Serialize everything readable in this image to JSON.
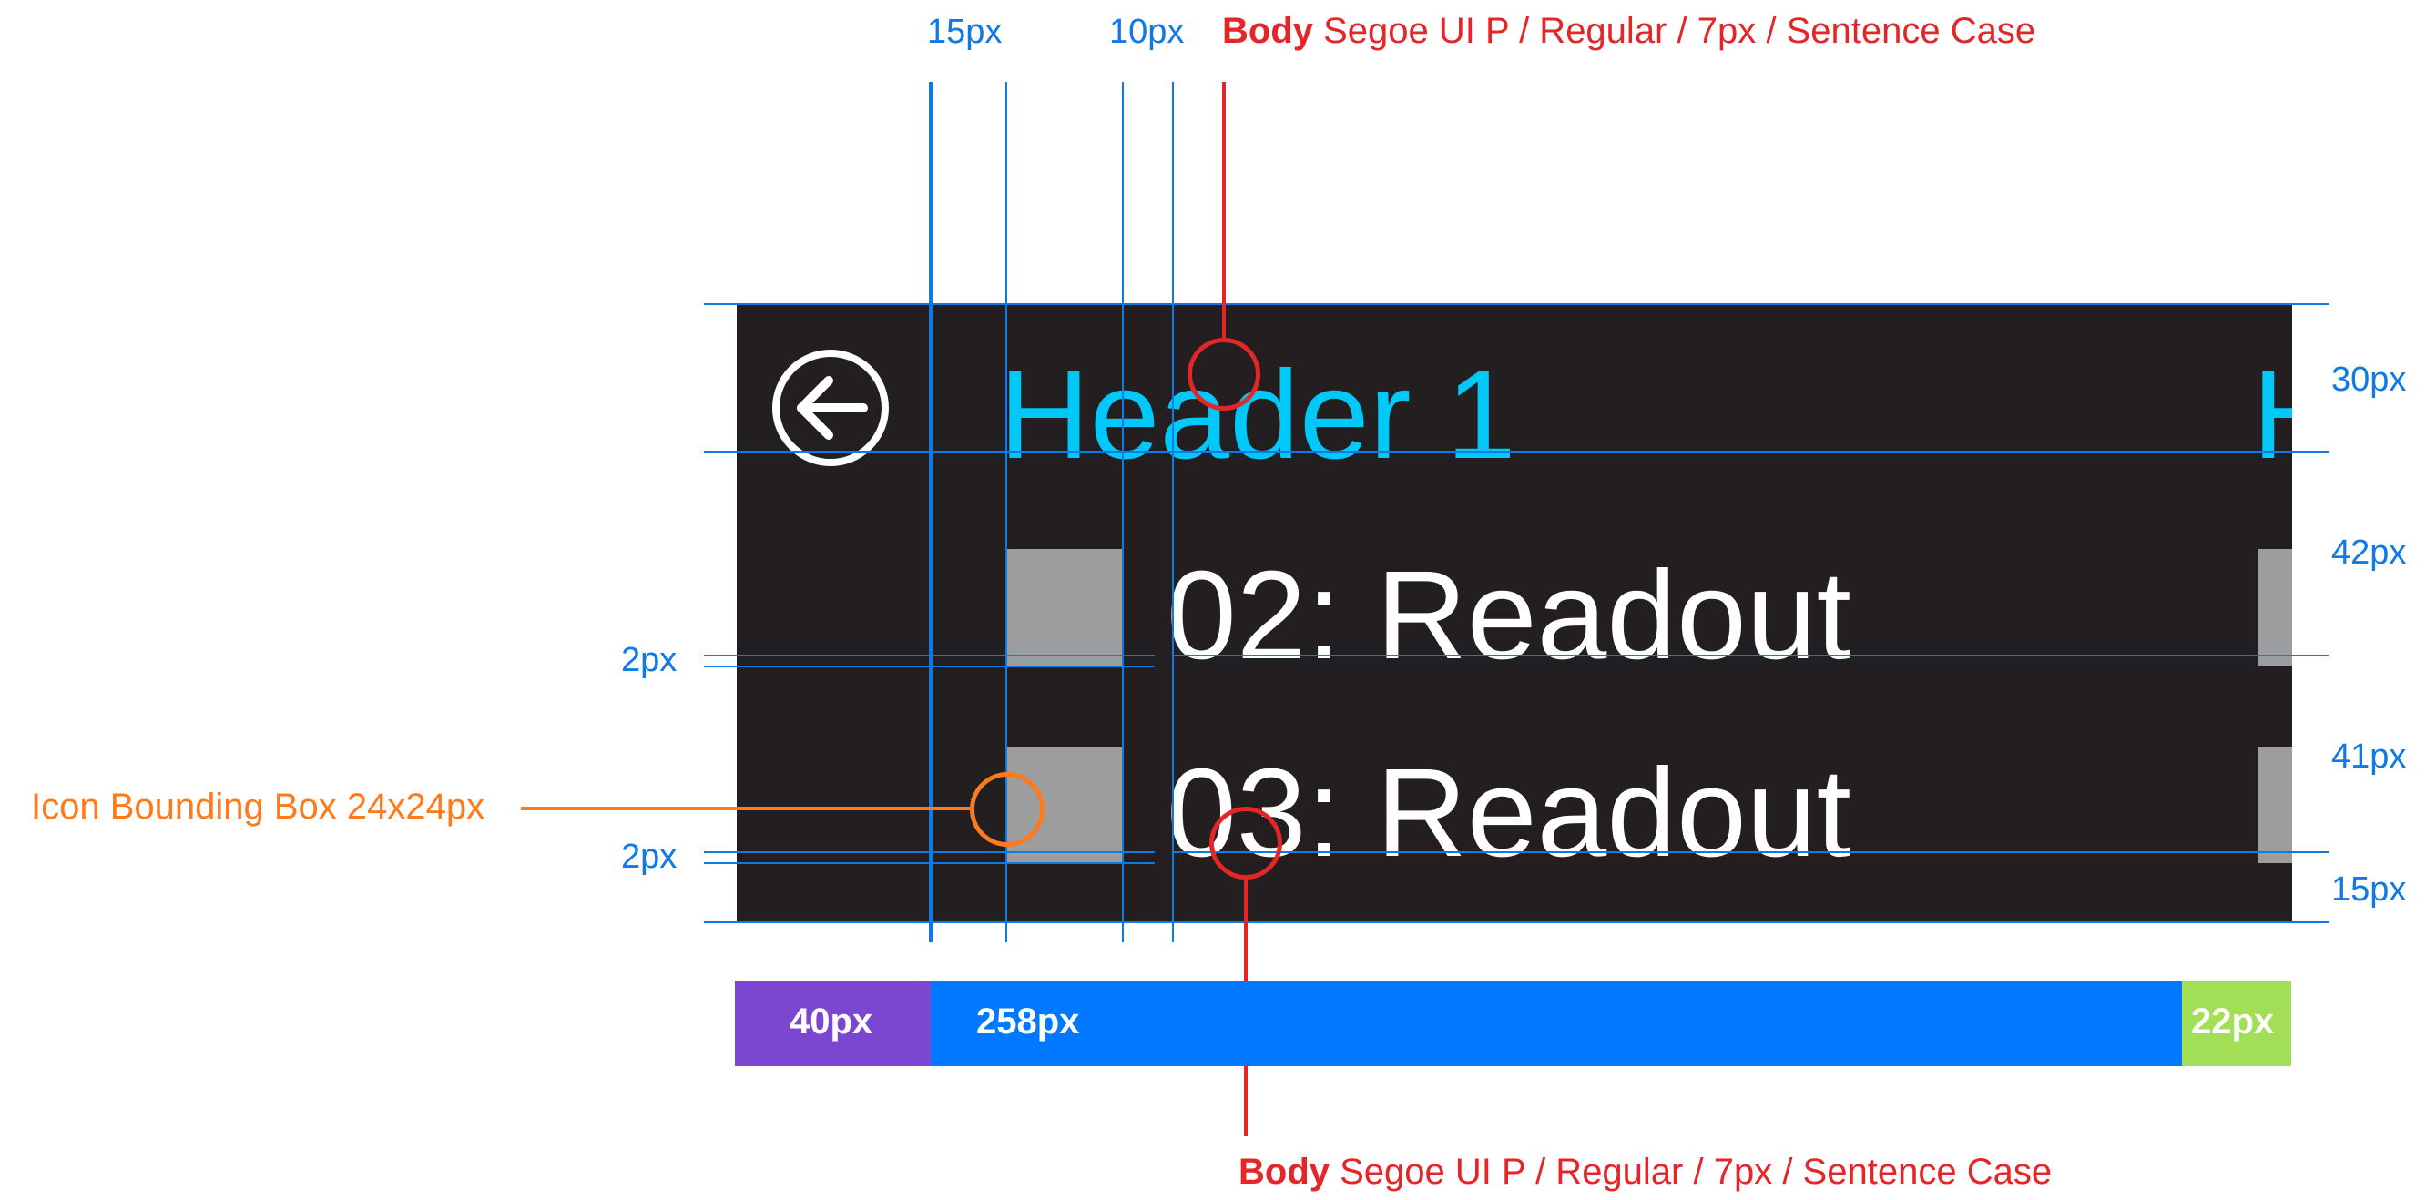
{
  "colors": {
    "panel_bg": "#231f20",
    "header_text": "#00c8f8",
    "readout_text": "#ffffff",
    "icon_box": "#9d9d9d",
    "guide": "#0f7ae5",
    "callout_red": "#e52629",
    "callout_orange": "#ff7a1a",
    "seg_purple": "#7b46d0",
    "seg_blue": "#0078ff",
    "seg_green": "#a3de57"
  },
  "screen": {
    "back_icon": "back-arrow-icon",
    "header": "Header 1",
    "next_header_peek": "H",
    "rows": [
      {
        "icon": "placeholder-square-icon",
        "label": "02: Readout"
      },
      {
        "icon": "placeholder-square-icon",
        "label": "03: Readout"
      }
    ]
  },
  "annotations": {
    "top_left_dim": "15px",
    "top_mid_dim": "10px",
    "left_gap_1": "2px",
    "left_gap_2": "2px",
    "right_dims": [
      "30px",
      "42px",
      "41px",
      "15px"
    ],
    "icon_bbox": "Icon Bounding Box 24x24px",
    "body_spec_top": {
      "bold": "Body",
      "rest": " Segoe UI P / Regular / 7px / Sentence Case"
    },
    "body_spec_bottom": {
      "bold": "Body",
      "rest": " Segoe UI P / Regular / 7px / Sentence Case"
    }
  },
  "width_bar": [
    {
      "label": "40px",
      "color": "#7b46d0"
    },
    {
      "label": "258px",
      "color": "#0078ff"
    },
    {
      "label": "22px",
      "color": "#a3de57"
    }
  ]
}
